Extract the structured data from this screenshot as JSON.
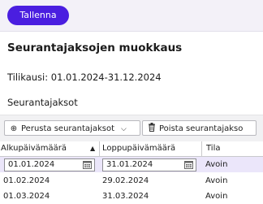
{
  "toolbar_top": {
    "save_label": "Tallenna"
  },
  "page": {
    "title": "Seurantajaksojen muokkaus",
    "period_text": "Tilikausi: 01.01.2024-31.12.2024",
    "section_label": "Seurantajaksot"
  },
  "actions": {
    "generate_label": "Perusta seurantajaksot",
    "delete_label": "Poista seurantajakso"
  },
  "grid": {
    "columns": [
      "Alkupäivämäärä",
      "Loppupäivämäärä",
      "Tila"
    ],
    "rows": [
      {
        "start": "01.01.2024",
        "end": "31.01.2024",
        "status": "Avoin",
        "editing": true
      },
      {
        "start": "01.02.2024",
        "end": "29.02.2024",
        "status": "Avoin",
        "editing": false
      },
      {
        "start": "01.03.2024",
        "end": "31.03.2024",
        "status": "Avoin",
        "editing": false
      }
    ]
  },
  "colors": {
    "accent": "#4a1ee0",
    "selected_row": "#ebe6fa",
    "topbar": "#f3f1f8"
  },
  "icons": {
    "generate": "plus-circle-icon",
    "dropdown": "chevron-down-icon",
    "delete": "trash-icon",
    "calendar": "calendar-icon",
    "sort": "sort-ascending-icon"
  }
}
